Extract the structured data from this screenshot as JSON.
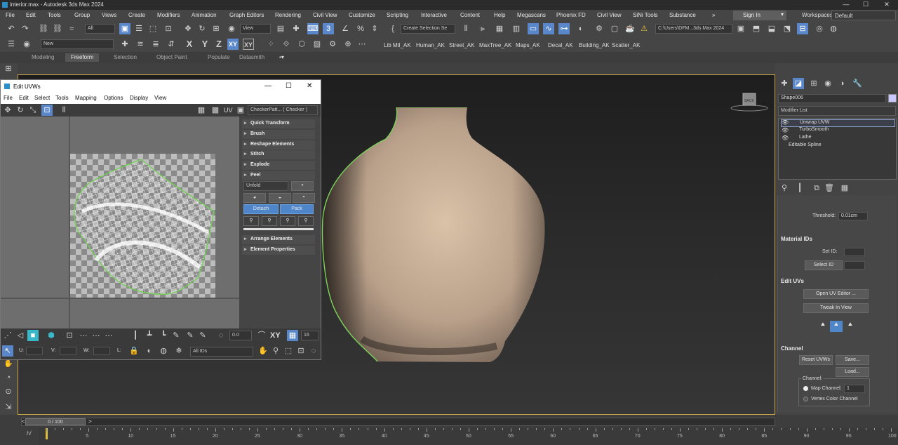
{
  "title": {
    "text": "interior.max - Autodesk 3ds Max 2024",
    "min": "—",
    "max": "☐",
    "close": "✕"
  },
  "menu": [
    "File",
    "Edit",
    "Tools",
    "Group",
    "Views",
    "Create",
    "Modifiers",
    "Animation",
    "Graph Editors",
    "Rendering",
    "Civil View",
    "Customize",
    "Scripting",
    "Interactive",
    "Content",
    "Help",
    "Megascans",
    "Phoenix FD",
    "Civil View",
    "SiNi Tools",
    "Substance"
  ],
  "signin": {
    "label": "Sign In",
    "chevron": "▾"
  },
  "workspaces": {
    "label": "Workspaces:",
    "value": "Default"
  },
  "toolbar1": {
    "filter": "All",
    "refcoord": "View",
    "selset": "Create Selection Se",
    "path": "C:\\Users\\DFM...3ds Max 2024"
  },
  "toolbar2": {
    "layer": "New",
    "axis_labels": [
      "X",
      "Y",
      "Z",
      "XY",
      "XY"
    ],
    "ak_tools": [
      "Lib Mtl_AK",
      "Human_AK",
      "Street_AK",
      "MaxTree_AK",
      "Maps_AK",
      "Decal_AK",
      "Building_AK",
      "Scatter_AK"
    ]
  },
  "ribbon": [
    "Modeling",
    "Freeform",
    "Selection",
    "Object Paint",
    "Populate",
    "Datasmith"
  ],
  "uv_editor": {
    "title": "Edit UVWs",
    "menu": [
      "File",
      "Edit",
      "Select",
      "Tools",
      "Mapping",
      "Options",
      "Display",
      "View"
    ],
    "uv_label": "UV",
    "checker": "CheckerPatt... ( Checker )",
    "rollouts": [
      "Quick Transform",
      "Brush",
      "Reshape Elements",
      "Stitch",
      "Explode",
      "Peel"
    ],
    "peel_mode": "Unfold",
    "detach": "Detach",
    "pack": "Pack",
    "rollouts2": [
      "Arrange Elements",
      "Element Properties"
    ],
    "bottom": {
      "value": "0.0",
      "xy": "XY",
      "count": "16",
      "u": "U:",
      "v": "V:",
      "w": "W:",
      "l": "L:",
      "ids": "All IDs"
    }
  },
  "cmd": {
    "object_name": "Shape006",
    "modifier_list": "Modifier List",
    "stack": [
      "Unwrap UVW",
      "TurboSmooth",
      "Lathe",
      "Editable Spline"
    ],
    "threshold_label": "Threshold:",
    "threshold": "0.01cm",
    "material_ids": "Material IDs",
    "set_id": "Set ID:",
    "select_id": "Select ID",
    "edit_uvs": "Edit UVs",
    "open_uv": "Open UV Editor ...",
    "tweak": "Tweak In View",
    "channel": "Channel",
    "reset_uvws": "Reset UVWs",
    "save": "Save...",
    "load": "Load...",
    "channel_label": "Channel:",
    "map_channel": "Map Channel:",
    "map_channel_value": "1",
    "vertex_color": "Vertex Color Channel"
  },
  "timeline": {
    "frame": "0 / 100",
    "ticks": [
      "0",
      "5",
      "10",
      "15",
      "20",
      "25",
      "30",
      "35",
      "40",
      "45",
      "50",
      "55",
      "60",
      "65",
      "70",
      "75",
      "80",
      "85",
      "90",
      "95",
      "100"
    ]
  },
  "viewcube_label": "BACK"
}
